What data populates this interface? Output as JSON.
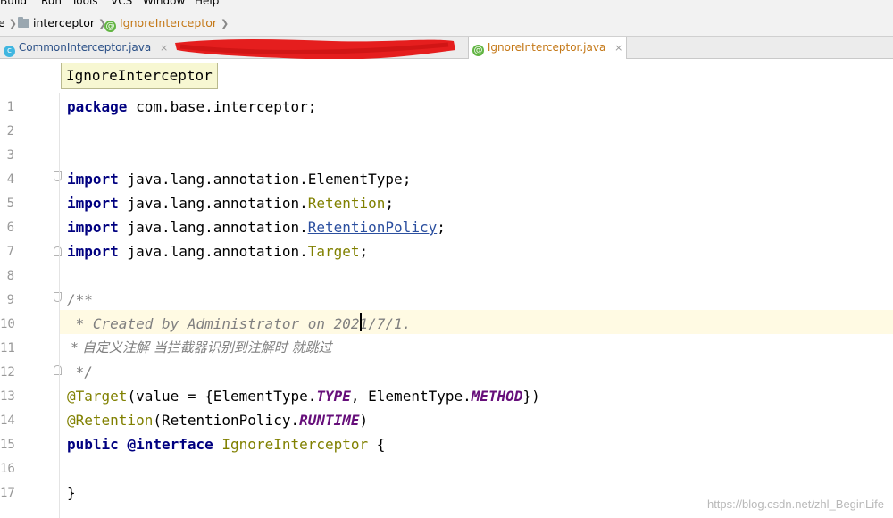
{
  "menu": [
    "Build",
    "Run",
    "Tools",
    "VCS",
    "Window",
    "Help"
  ],
  "breadcrumb": {
    "items": [
      {
        "label": "e",
        "icon": "folder-icon"
      },
      {
        "label": "interceptor",
        "icon": "folder-icon"
      },
      {
        "label": "IgnoreInterceptor",
        "icon": "annotation-icon"
      }
    ]
  },
  "tabs": [
    {
      "label": "CommonInterceptor.java",
      "icon": "class-icon",
      "close": "×"
    },
    {
      "label": "IgnoreInterceptor.java",
      "icon": "annotation-icon",
      "close": "×",
      "active": true
    }
  ],
  "tooltip": "IgnoreInterceptor",
  "gutter": {
    "line_numbers": [
      "1",
      "2",
      "3",
      "4",
      "5",
      "6",
      "7",
      "8",
      "9",
      "10",
      "11",
      "12",
      "13",
      "14",
      "15",
      "16",
      "17"
    ]
  },
  "code": {
    "l1": {
      "kw": "package",
      "rest": " com.base.interceptor;"
    },
    "l4": {
      "kw": "import",
      "pre": " java.lang.annotation.",
      "cls": "ElementType",
      "post": ";"
    },
    "l5": {
      "kw": "import",
      "pre": " java.lang.annotation.",
      "cls": "Retention",
      "post": ";"
    },
    "l6": {
      "kw": "import",
      "pre": " java.lang.annotation.",
      "cls": "RetentionPolicy",
      "post": ";"
    },
    "l7": {
      "kw": "import",
      "pre": " java.lang.annotation.",
      "cls": "Target",
      "post": ";"
    },
    "l9": "/**",
    "l10": " * Created by Administrator on 2021/7/1.",
    "l11": " * 自定义注解 当拦截器识别到注解时 就跳过",
    "l12": " */",
    "l13": {
      "anno": "@Target",
      "a": "(value = {ElementType.",
      "c1": "TYPE",
      "b": ", ElementType.",
      "c2": "METHOD",
      "d": "})"
    },
    "l14": {
      "anno": "@Retention",
      "a": "(RetentionPolicy.",
      "c1": "RUNTIME",
      "d": ")"
    },
    "l15": {
      "kw1": "public",
      "sp": " ",
      "kw2": "@interface",
      "sp2": " ",
      "name": "IgnoreInterceptor",
      "rest": " {"
    },
    "l17": "}"
  },
  "watermark": "https://blog.csdn.net/zhl_BeginLife"
}
